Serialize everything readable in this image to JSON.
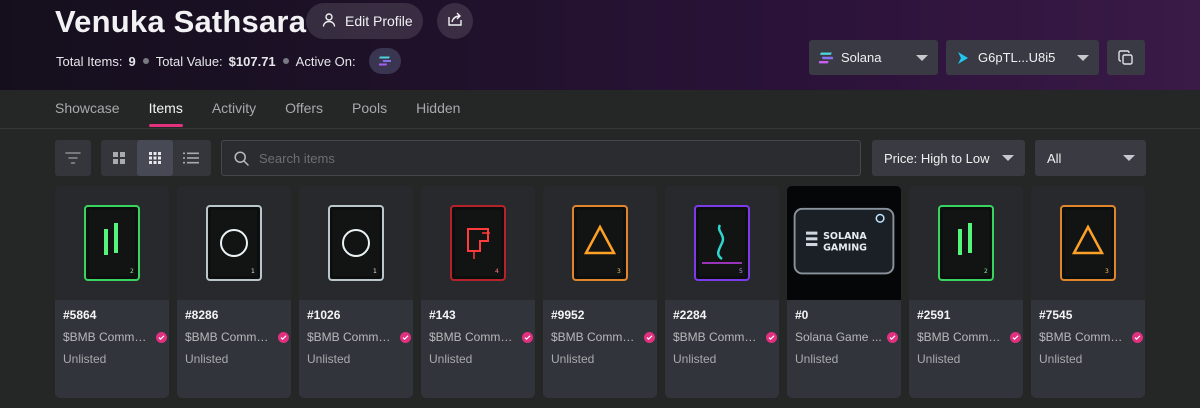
{
  "profile": {
    "name": "Venuka Sathsara",
    "edit_label": "Edit Profile"
  },
  "stats": {
    "total_items_label": "Total Items:",
    "total_items": "9",
    "total_value_label": "Total Value:",
    "total_value": "$107.71",
    "active_on_label": "Active On:"
  },
  "chain_select": {
    "value": "Solana"
  },
  "wallet_select": {
    "value": "G6pTL...U8i5"
  },
  "tabs": [
    {
      "label": "Showcase",
      "active": false
    },
    {
      "label": "Items",
      "active": true
    },
    {
      "label": "Activity",
      "active": false
    },
    {
      "label": "Offers",
      "active": false
    },
    {
      "label": "Pools",
      "active": false
    },
    {
      "label": "Hidden",
      "active": false
    }
  ],
  "toolbar": {
    "search_placeholder": "Search items",
    "sort_value": "Price: High to Low",
    "filter_value": "All"
  },
  "colors": {
    "accent": "#e4317e",
    "header_start": "#150f1d",
    "header_end": "#3a1a47"
  },
  "items": [
    {
      "number": "#5864",
      "collection": "$BMB Commu...",
      "status": "Unlisted",
      "art": "green-bars"
    },
    {
      "number": "#8286",
      "collection": "$BMB Commu...",
      "status": "Unlisted",
      "art": "white-ring"
    },
    {
      "number": "#1026",
      "collection": "$BMB Commu...",
      "status": "Unlisted",
      "art": "white-ring"
    },
    {
      "number": "#143",
      "collection": "$BMB Commu...",
      "status": "Unlisted",
      "art": "red-square"
    },
    {
      "number": "#9952",
      "collection": "$BMB Commu...",
      "status": "Unlisted",
      "art": "orange-triangle"
    },
    {
      "number": "#2284",
      "collection": "$BMB Commu...",
      "status": "Unlisted",
      "art": "purple-wave"
    },
    {
      "number": "#0",
      "collection": "Solana Game ...",
      "status": "Unlisted",
      "art": "solana-gaming-card"
    },
    {
      "number": "#2591",
      "collection": "$BMB Commu...",
      "status": "Unlisted",
      "art": "green-bars"
    },
    {
      "number": "#7545",
      "collection": "$BMB Commu...",
      "status": "Unlisted",
      "art": "orange-triangle"
    }
  ]
}
